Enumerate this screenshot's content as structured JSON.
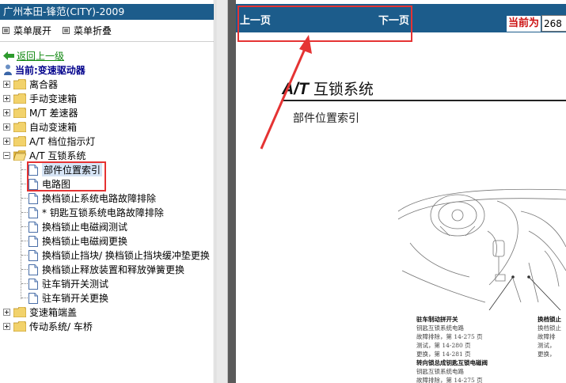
{
  "left_pane": {
    "title": "广州本田-锋范(CITY)-2009",
    "menu_expand": "菜单展开",
    "menu_collapse": "菜单折叠",
    "back_link": "返回上一级",
    "current": "当前:变速驱动器",
    "tree": {
      "folders": [
        {
          "label": "离合器",
          "state": "collapsed"
        },
        {
          "label": "手动变速箱",
          "state": "collapsed"
        },
        {
          "label": "M/T 差速器",
          "state": "collapsed"
        },
        {
          "label": "自动变速箱",
          "state": "collapsed"
        },
        {
          "label": "A/T 档位指示灯",
          "state": "collapsed"
        },
        {
          "label": "A/T 互锁系统",
          "state": "expanded"
        }
      ],
      "children": [
        {
          "label": "部件位置索引",
          "selected": true
        },
        {
          "label": "电路图"
        },
        {
          "label": "换档锁止系统电路故障排除"
        },
        {
          "label": "* 钥匙互锁系统电路故障排除"
        },
        {
          "label": "换档锁止电磁阀测试"
        },
        {
          "label": "换档锁止电磁阀更换"
        },
        {
          "label": "换档锁止挡块/ 换档锁止挡块缓冲垫更换"
        },
        {
          "label": "换档锁止释放装置和释放弹簧更换"
        },
        {
          "label": "驻车销开关测试"
        },
        {
          "label": "驻车销开关更换"
        }
      ],
      "folders_after": [
        {
          "label": "变速箱端盖",
          "state": "collapsed"
        },
        {
          "label": "传动系统/ 车桥",
          "state": "collapsed"
        }
      ]
    }
  },
  "right_pane": {
    "prev_page": "上一页",
    "next_page": "下一页",
    "current_label": "当前为",
    "page_value": "268",
    "doc_title_prefix": "A/T",
    "doc_title": "互锁系统",
    "doc_subtitle": "部件位置索引",
    "caption_left": {
      "heading": "驻车制动拼开关",
      "lines": [
        "钥匙互锁系统电路",
        "故障排除，第 14-275 页",
        "测试，第 14-280 页",
        "更换，第 14-281 页"
      ],
      "heading2": "转向锁总成钥匙互锁电磁阀",
      "lines2": [
        "钥匙互锁系统电路",
        "故障排除，第 14-275 页"
      ]
    },
    "caption_right": {
      "heading": "换档锁止",
      "lines": [
        "换档锁止",
        "故障排",
        "测试，",
        "更换，"
      ]
    }
  },
  "colors": {
    "header_blue": "#1c5c8b",
    "annotation_red": "#e53333",
    "link_green": "#118811",
    "current_label_red": "#cc1111"
  }
}
